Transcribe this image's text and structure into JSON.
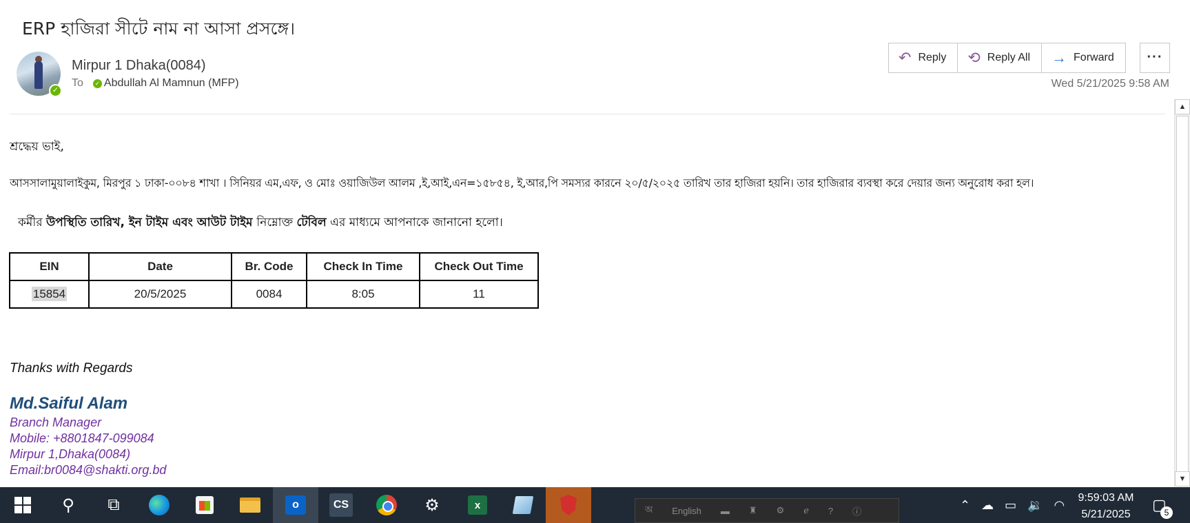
{
  "email": {
    "subject": "ERP হাজিরা  সীটে নাম না আসা প্রসঙ্গে।",
    "sender": "Mirpur 1 Dhaka(0084)",
    "to_label": "To",
    "recipient": "Abdullah Al Mamnun (MFP)",
    "datetime": "Wed 5/21/2025 9:58 AM"
  },
  "actions": {
    "reply": "Reply",
    "reply_all": "Reply All",
    "forward": "Forward",
    "more": "···"
  },
  "body": {
    "greeting": "শ্রদ্ধেয়  ভাই,",
    "para1": "আসসালামুয়ালাইকুম, মিরপুর ১ ঢাকা-০০৮৪ শাখা । সিনিয়র এম,এফ, ও মোঃ ওয়াজিউল আলম ,ই,আই,এন=১৫৮৫৪,  ই,আর,পি সমস্যর কারনে ২০/৫/২০২৫ তারিখ  তার হাজিরা হয়নি। তার হাজিরার ব্যবস্থা করে দেয়ার জন্য অনুরোধ করা হল।",
    "para2_a": "কর্মীর ",
    "para2_b": " উপস্থিতি তারিখ, ইন টাইম এবং আউট টাইম ",
    "para2_c": "নিম্নোক্ত ",
    "para2_d": "টেবিল",
    "para2_e": " এর  মাধ্যমে  আপনাকে  জানানো  হলো।"
  },
  "table": {
    "headers": [
      "EIN",
      "Date",
      "Br. Code",
      "Check In Time",
      "Check Out Time"
    ],
    "row": [
      "15854",
      "20/5/2025",
      "0084",
      "8:05",
      "11"
    ]
  },
  "signature": {
    "thanks": "Thanks with Regards",
    "name": "Md.Saiful Alam",
    "title": "Branch Manager",
    "mobile": "Mobile: +8801847-099084",
    "branch": "Mirpur 1,Dhaka(0084)",
    "email": "Email:br0084@shakti.org.bd"
  },
  "language_bar": {
    "language": "English"
  },
  "tray": {
    "time": "9:59:03 AM",
    "date": "5/21/2025",
    "notification_count": "5"
  },
  "taskbar_icons": [
    "windows-start-icon",
    "search-icon",
    "task-view-icon",
    "edge-icon",
    "store-icon",
    "file-explorer-icon",
    "outlook-icon",
    "cs-app-icon",
    "chrome-icon",
    "settings-gear-icon",
    "excel-icon",
    "notes-app-icon",
    "shield-app-icon"
  ],
  "colors": {
    "presence": "#6bb700",
    "signature_name": "#1f4e79",
    "signature_lines": "#7030a0",
    "taskbar": "#1f2a36"
  }
}
